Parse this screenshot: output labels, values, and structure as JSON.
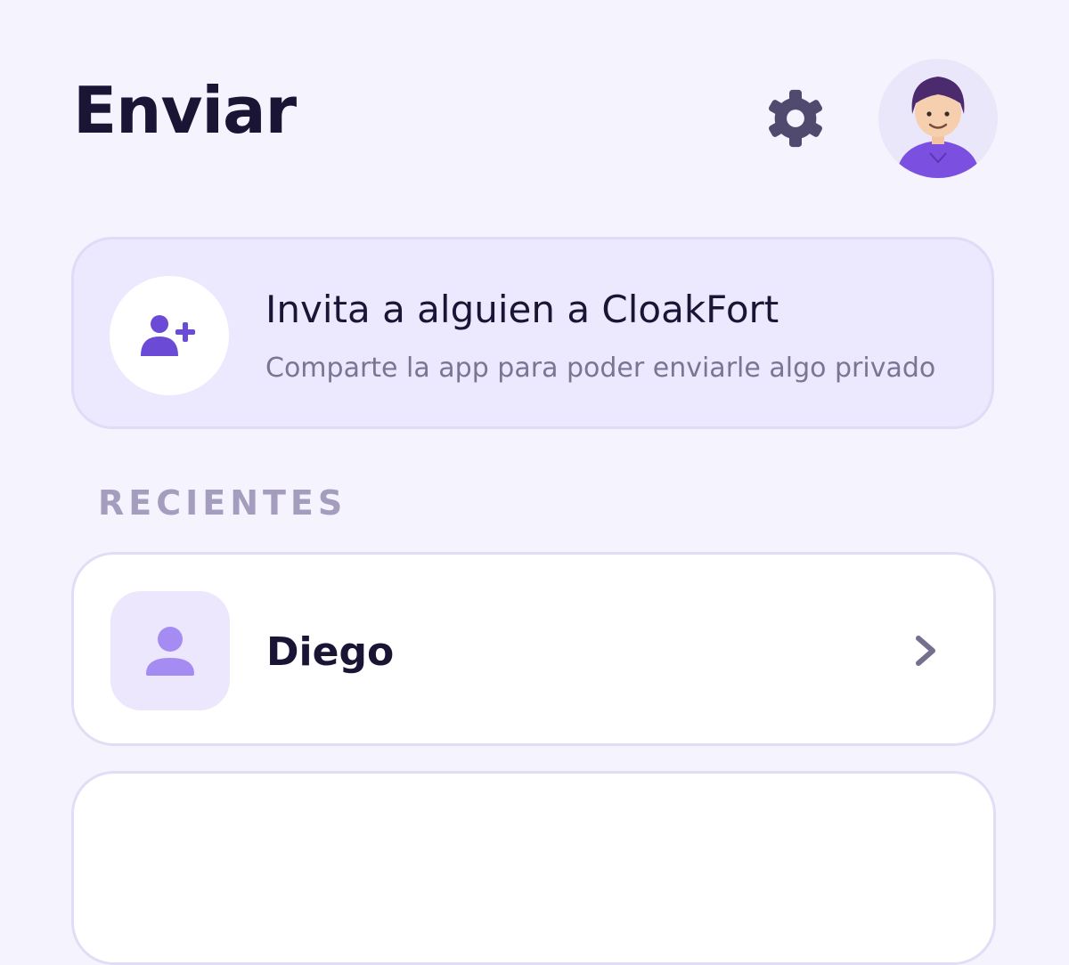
{
  "header": {
    "title": "Enviar",
    "settings_icon": "gear-icon",
    "avatar_icon": "user-avatar"
  },
  "invite": {
    "title": "Invita a alguien a CloakFort",
    "subtitle": "Comparte la app para poder enviarle algo privado",
    "icon": "add-user-icon"
  },
  "recent": {
    "heading": "RECIENTES",
    "contacts": [
      {
        "name": "Diego",
        "icon": "person-icon"
      }
    ]
  },
  "colors": {
    "background": "#f5f3fd",
    "accent": "#6f4fd8",
    "title_text": "#1b1535",
    "muted_text": "#7a7593",
    "section_heading": "#a49dbd",
    "invite_card": "#ece8fe",
    "gear": "#4f4a6e"
  }
}
